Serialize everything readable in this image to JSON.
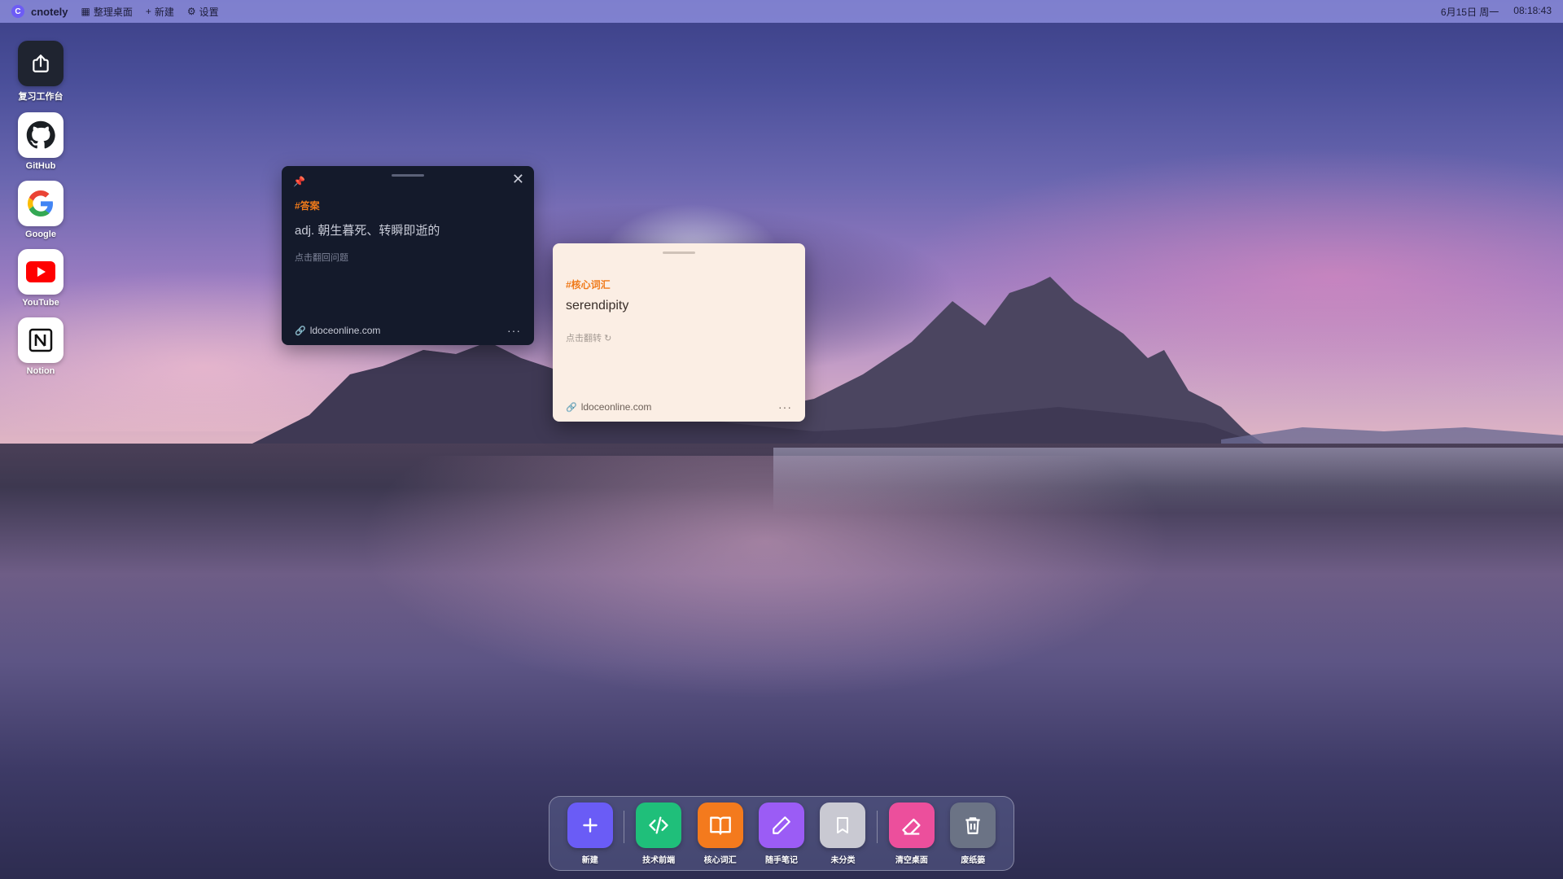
{
  "topbar": {
    "logo_letter": "C",
    "app_name": "cnotely",
    "menu": [
      {
        "icon": "grid-icon",
        "label": "整理桌面"
      },
      {
        "icon": "plus-icon",
        "label": "新建"
      },
      {
        "icon": "gear-icon",
        "label": "设置"
      }
    ],
    "date": "6月15日 周一",
    "time": "08:18:43"
  },
  "desktop_icons": [
    {
      "name": "review-workbench",
      "label": "复习工作台",
      "icon": "export-icon"
    },
    {
      "name": "github",
      "label": "GitHub",
      "icon": "github-icon"
    },
    {
      "name": "google",
      "label": "Google",
      "icon": "google-icon"
    },
    {
      "name": "youtube",
      "label": "YouTube",
      "icon": "youtube-icon"
    },
    {
      "name": "notion",
      "label": "Notion",
      "icon": "notion-icon"
    }
  ],
  "cards": {
    "answer": {
      "tag": "#答案",
      "text": "adj. 朝生暮死、转瞬即逝的",
      "hint": "点击翻回问题",
      "source": "ldoceonline.com"
    },
    "word": {
      "tag": "#核心词汇",
      "text": "serendipity",
      "hint": "点击翻转",
      "source": "ldoceonline.com"
    }
  },
  "dock": [
    {
      "label": "新建",
      "icon": "plus-icon",
      "color": "#6a5cf6"
    },
    {
      "label": "技术前端",
      "icon": "code-icon",
      "color": "#1fbf7a"
    },
    {
      "label": "核心词汇",
      "icon": "book-icon",
      "color": "#f47a1d"
    },
    {
      "label": "随手笔记",
      "icon": "pencil-icon",
      "color": "#9b5cf5"
    },
    {
      "label": "未分类",
      "icon": "bookmark-icon",
      "color": "#c9c9d2"
    },
    {
      "label": "清空桌面",
      "icon": "eraser-icon",
      "color": "#ec4f9c"
    },
    {
      "label": "废纸篓",
      "icon": "trash-icon",
      "color": "#6b7385"
    }
  ],
  "colors": {
    "accent_tag": "#f07a1a",
    "card_dark_bg": "#141a2b",
    "card_light_bg": "#fbeee4"
  }
}
